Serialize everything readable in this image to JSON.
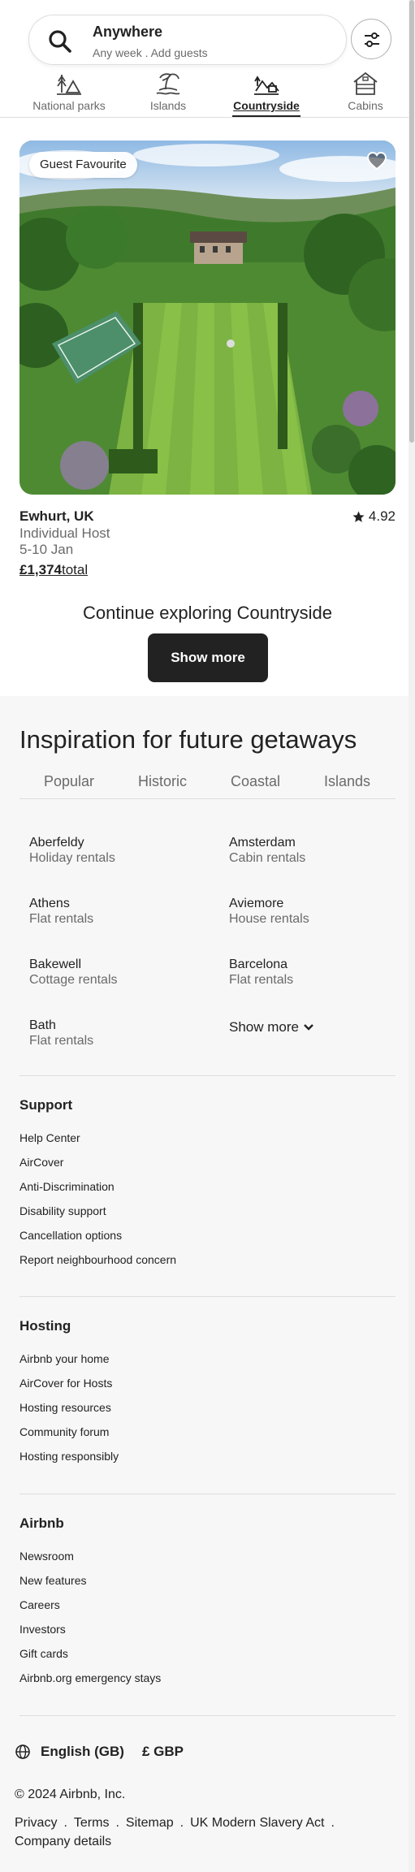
{
  "search": {
    "title": "Anywhere",
    "subtitle": "Any week . Add guests"
  },
  "categories": [
    {
      "label": "National parks",
      "icon": "national-parks-icon",
      "active": false
    },
    {
      "label": "Islands",
      "icon": "islands-icon",
      "active": false
    },
    {
      "label": "Countryside",
      "icon": "countryside-icon",
      "active": true
    },
    {
      "label": "Cabins",
      "icon": "cabins-icon",
      "active": false
    }
  ],
  "listing": {
    "badge": "Guest Favourite",
    "location": "Ewhurt, UK",
    "rating": "4.92",
    "host": "Individual Host",
    "dates": "5-10 Jan",
    "price": "£1,374",
    "price_suffix": "total"
  },
  "continue_text": "Continue exploring Countryside",
  "show_more_button": "Show more",
  "inspiration": {
    "title": "Inspiration for future getaways",
    "tabs": [
      "Popular",
      "Historic",
      "Coastal",
      "Islands"
    ],
    "destinations": [
      {
        "name": "Aberfeldy",
        "type": "Holiday rentals"
      },
      {
        "name": "Amsterdam",
        "type": "Cabin rentals"
      },
      {
        "name": "Athens",
        "type": "Flat rentals"
      },
      {
        "name": "Aviemore",
        "type": "House rentals"
      },
      {
        "name": "Bakewell",
        "type": "Cottage rentals"
      },
      {
        "name": "Barcelona",
        "type": "Flat rentals"
      },
      {
        "name": "Bath",
        "type": "Flat rentals"
      }
    ],
    "show_more": "Show more"
  },
  "footer": {
    "support": {
      "heading": "Support",
      "links": [
        "Help Center",
        "AirCover",
        "Anti-Discrimination",
        "Disability support",
        "Cancellation options",
        "Report neighbourhood concern"
      ]
    },
    "hosting": {
      "heading": "Hosting",
      "links": [
        "Airbnb your home",
        "AirCover for Hosts",
        "Hosting resources",
        "Community forum",
        "Hosting responsibly"
      ]
    },
    "airbnb": {
      "heading": "Airbnb",
      "links": [
        "Newsroom",
        "New features",
        "Careers",
        "Investors",
        "Gift cards",
        "Airbnb.org emergency stays"
      ]
    },
    "language": "English (GB)",
    "currency": "£ GBP",
    "copyright": "© 2024 Airbnb, Inc.",
    "legal": [
      "Privacy",
      "Terms",
      "Sitemap",
      "UK Modern Slavery Act",
      "Company details"
    ]
  },
  "colors": {
    "text": "#222222",
    "muted": "#6a6a6a",
    "section_bg": "#f7f7f7",
    "button": "#222222"
  }
}
